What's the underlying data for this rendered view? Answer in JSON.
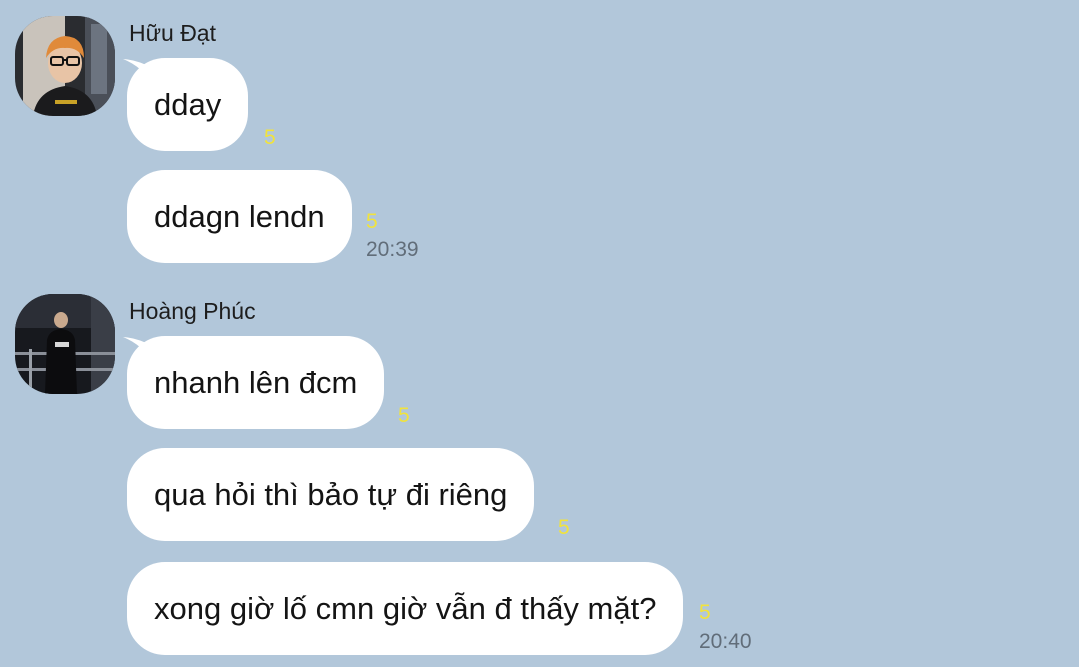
{
  "colors": {
    "background": "#b2c7da",
    "bubble": "#ffffff",
    "unread_count": "#f1e33c",
    "timestamp": "#616d79"
  },
  "groups": [
    {
      "sender": "Hữu Đạt",
      "avatar_icon": "profile-photo-person-glasses-orange-hair",
      "messages": [
        {
          "text": "dday",
          "unread": "5"
        },
        {
          "text": "ddagn lendn",
          "unread": "5",
          "time": "20:39"
        }
      ]
    },
    {
      "sender": "Hoàng Phúc",
      "avatar_icon": "profile-photo-person-dark-room",
      "messages": [
        {
          "text": "nhanh lên đcm",
          "unread": "5"
        },
        {
          "text": "qua hỏi thì bảo tự đi riêng",
          "unread": "5"
        },
        {
          "text": "xong giờ lố cmn giờ vẫn đ thấy mặt?",
          "unread": "5",
          "time": "20:40"
        }
      ]
    }
  ]
}
